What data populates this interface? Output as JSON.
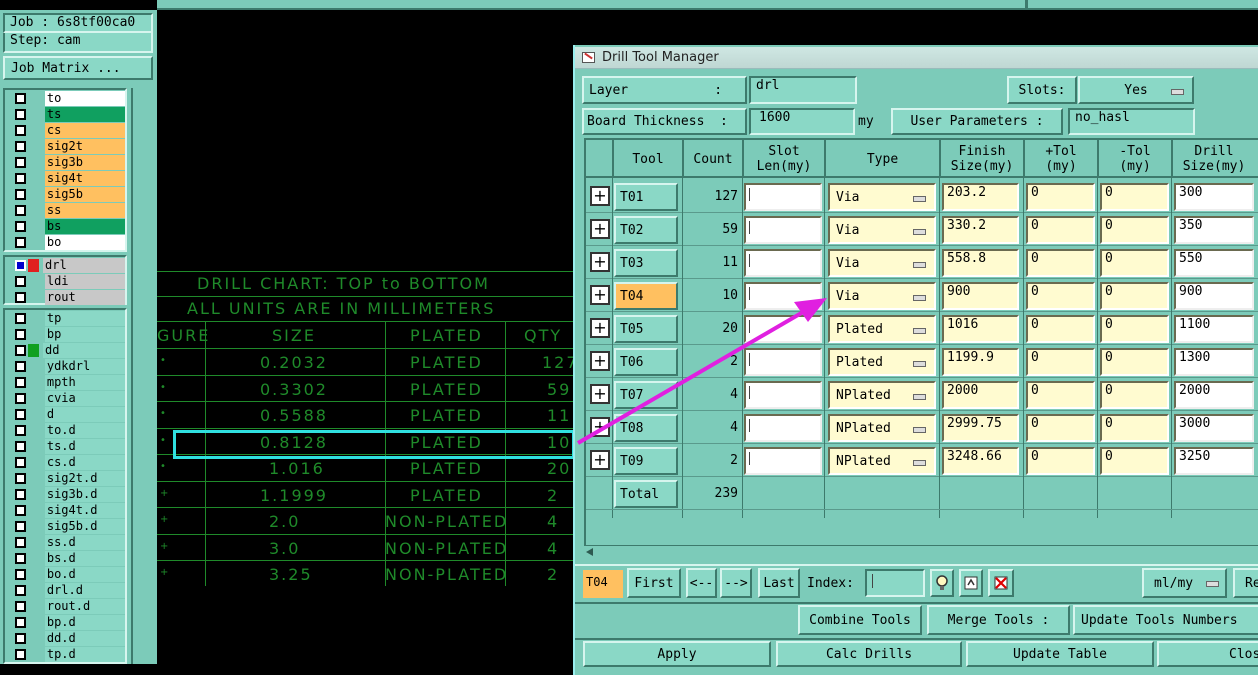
{
  "left_panel": {
    "job": "Job : 6s8tf00ca0",
    "step": "Step: cam",
    "job_matrix_button": "Job Matrix ...",
    "layers_group1": [
      {
        "name": "to",
        "color": "#ffffff"
      },
      {
        "name": "ts",
        "color": "#10a060"
      },
      {
        "name": "cs",
        "color": "#ffc060"
      },
      {
        "name": "sig2t",
        "color": "#ffc060"
      },
      {
        "name": "sig3b",
        "color": "#ffc060"
      },
      {
        "name": "sig4t",
        "color": "#ffc060"
      },
      {
        "name": "sig5b",
        "color": "#ffc060"
      },
      {
        "name": "ss",
        "color": "#ffc060"
      },
      {
        "name": "bs",
        "color": "#10a060"
      },
      {
        "name": "bo",
        "color": "#ffffff"
      }
    ],
    "layers_group2": [
      {
        "name": "drl",
        "color": "#c8c8c8"
      },
      {
        "name": "ldi",
        "color": "#c8c8c8"
      },
      {
        "name": "rout",
        "color": "#c8c8c8"
      }
    ],
    "layers_group3": [
      "tp",
      "bp",
      "dd",
      "ydkdrl",
      "mpth",
      "cvia",
      "d",
      "to.d",
      "ts.d",
      "cs.d",
      "sig2t.d",
      "sig3b.d",
      "sig4t.d",
      "sig5b.d",
      "ss.d",
      "bs.d",
      "bo.d",
      "drl.d",
      "rout.d",
      "bp.d",
      "dd.d",
      "tp.d"
    ]
  },
  "drill_chart": {
    "title1": "DRILL CHART: TOP to BOTTOM",
    "title2": "ALL UNITS ARE IN MILLIMETERS",
    "headers": [
      "GURE",
      "SIZE",
      "PLATED",
      "QTY"
    ],
    "rows": [
      {
        "size": "0.2032",
        "plated": "PLATED",
        "qty": "127"
      },
      {
        "size": "0.3302",
        "plated": "PLATED",
        "qty": "59"
      },
      {
        "size": "0.5588",
        "plated": "PLATED",
        "qty": "11"
      },
      {
        "size": "0.8128",
        "plated": "PLATED",
        "qty": "10"
      },
      {
        "size": "1.016",
        "plated": "PLATED",
        "qty": "20"
      },
      {
        "size": "1.1999",
        "plated": "PLATED",
        "qty": "2"
      },
      {
        "size": "2.0",
        "plated": "NON-PLATED",
        "qty": "4"
      },
      {
        "size": "3.0",
        "plated": "NON-PLATED",
        "qty": "4"
      },
      {
        "size": "3.25",
        "plated": "NON-PLATED",
        "qty": "2"
      }
    ]
  },
  "dialog": {
    "title": "Drill Tool Manager",
    "layer_label": "Layer           :",
    "layer_value": "drl",
    "slots_label": "Slots:",
    "slots_value": "Yes",
    "board_thickness_label": "Board Thickness  :",
    "board_thickness_value": "1600",
    "board_thickness_unit": "my",
    "user_params_label": "User Parameters :",
    "user_params_value": "no_hasl",
    "columns": {
      "tool": "Tool",
      "count": "Count",
      "slot1": "Slot",
      "slot2": "Len(my)",
      "type": "Type",
      "finish1": "Finish",
      "finish2": "Size(my)",
      "ptol1": "+Tol",
      "ptol2": "(my)",
      "mtol1": "-Tol",
      "mtol2": "(my)",
      "drill1": "Drill",
      "drill2": "Size(my)"
    },
    "rows": [
      {
        "tool": "T01",
        "count": "127",
        "type": "Via",
        "finish": "203.2",
        "ptol": "0",
        "mtol": "0",
        "drill": "300"
      },
      {
        "tool": "T02",
        "count": "59",
        "type": "Via",
        "finish": "330.2",
        "ptol": "0",
        "mtol": "0",
        "drill": "350"
      },
      {
        "tool": "T03",
        "count": "11",
        "type": "Via",
        "finish": "558.8",
        "ptol": "0",
        "mtol": "0",
        "drill": "550"
      },
      {
        "tool": "T04",
        "count": "10",
        "type": "Via",
        "finish": "900",
        "ptol": "0",
        "mtol": "0",
        "drill": "900"
      },
      {
        "tool": "T05",
        "count": "20",
        "type": "Plated",
        "finish": "1016",
        "ptol": "0",
        "mtol": "0",
        "drill": "1100"
      },
      {
        "tool": "T06",
        "count": "2",
        "type": "Plated",
        "finish": "1199.9",
        "ptol": "0",
        "mtol": "0",
        "drill": "1300"
      },
      {
        "tool": "T07",
        "count": "4",
        "type": "NPlated",
        "finish": "2000",
        "ptol": "0",
        "mtol": "0",
        "drill": "2000"
      },
      {
        "tool": "T08",
        "count": "4",
        "type": "NPlated",
        "finish": "2999.75",
        "ptol": "0",
        "mtol": "0",
        "drill": "3000"
      },
      {
        "tool": "T09",
        "count": "2",
        "type": "NPlated",
        "finish": "3248.66",
        "ptol": "0",
        "mtol": "0",
        "drill": "3250"
      }
    ],
    "selected_tool": "T04",
    "total_label": "Total",
    "total_value": "239",
    "nav": {
      "current": "T04",
      "first": "First",
      "prev": "<--",
      "next": "-->",
      "last": "Last",
      "index_label": "Index:",
      "units": "ml/my",
      "re": "Re"
    },
    "actions": {
      "combine": "Combine Tools",
      "merge": "Merge Tools :",
      "update_numbers": "Update Tools Numbers"
    },
    "bottom": {
      "apply": "Apply",
      "calc": "Calc Drills",
      "update_table": "Update Table",
      "close": "Clos"
    }
  },
  "colors": {
    "panel": "#7ccbb9",
    "button": "#8ad8c6",
    "field": "#fffbd0",
    "selected": "#ffc060",
    "chart_green": "#1f8a2a",
    "highlight_box": "#30e0e0",
    "arrow": "#e020e0"
  }
}
